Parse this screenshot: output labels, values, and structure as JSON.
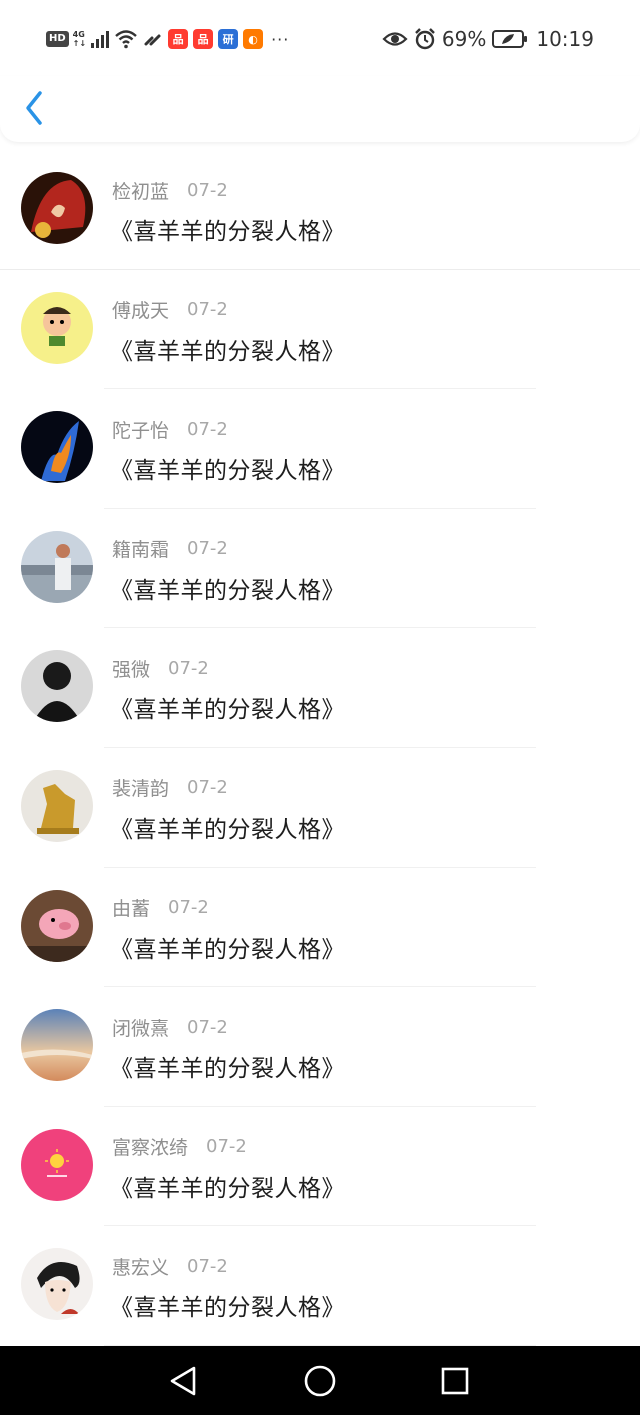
{
  "status_bar": {
    "hd": "HD",
    "network": "4G",
    "signal_sub": "↑↓",
    "more": "···",
    "battery_pct": "69%",
    "time": "10:19",
    "apps": [
      {
        "name": "app-icon-1",
        "glyph": "品",
        "color": "#ff3b30"
      },
      {
        "name": "app-icon-2",
        "glyph": "品",
        "color": "#ff3b30"
      },
      {
        "name": "app-icon-3",
        "glyph": "研",
        "color": "#2b6fd6"
      },
      {
        "name": "app-icon-4",
        "glyph": "◐",
        "color": "#ff7a00"
      }
    ]
  },
  "header": {
    "back_icon": "chevron-left-icon",
    "accent_color": "#2a93e6"
  },
  "comments": [
    {
      "user": "检初蓝",
      "date": "07-2",
      "message": "《喜羊羊的分裂人格》",
      "avatar": "anime-red-hair"
    },
    {
      "user": "傅成天",
      "date": "07-2",
      "message": "《喜羊羊的分裂人格》",
      "avatar": "cartoon-boy"
    },
    {
      "user": "陀子怡",
      "date": "07-2",
      "message": "《喜羊羊的分裂人格》",
      "avatar": "fire-smoke"
    },
    {
      "user": "籍南霜",
      "date": "07-2",
      "message": "《喜羊羊的分裂人格》",
      "avatar": "city-person"
    },
    {
      "user": "强微",
      "date": "07-2",
      "message": "《喜羊羊的分裂人格》",
      "avatar": "dark-portrait"
    },
    {
      "user": "裴清韵",
      "date": "07-2",
      "message": "《喜羊羊的分裂人格》",
      "avatar": "golden-horse"
    },
    {
      "user": "由蓄",
      "date": "07-2",
      "message": "《喜羊羊的分裂人格》",
      "avatar": "pink-pig"
    },
    {
      "user": "闭微熹",
      "date": "07-2",
      "message": "《喜羊羊的分裂人格》",
      "avatar": "sunset-sky"
    },
    {
      "user": "富察浓绮",
      "date": "07-2",
      "message": "《喜羊羊的分裂人格》",
      "avatar": "pink-sun"
    },
    {
      "user": "惠宏义",
      "date": "07-2",
      "message": "《喜羊羊的分裂人格》",
      "avatar": "anime-sketch"
    }
  ],
  "nav_bar": {
    "back": "triangle-back-icon",
    "home": "circle-home-icon",
    "recents": "square-recents-icon"
  }
}
